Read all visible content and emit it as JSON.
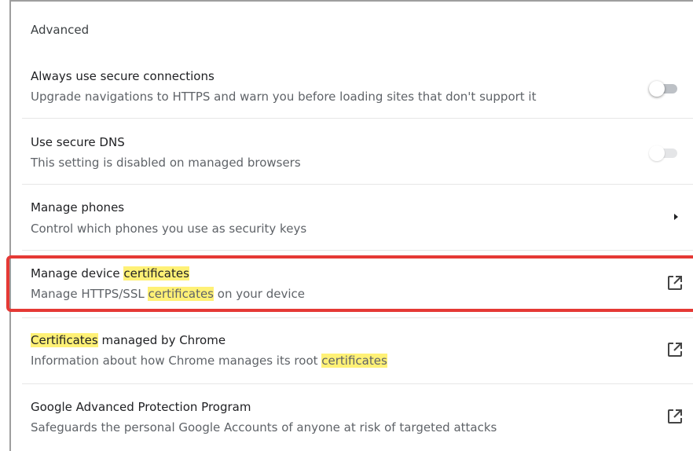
{
  "section_title": "Advanced",
  "highlight_term": "certificates",
  "colors": {
    "highlight": "#fff176",
    "focus_outline": "#e53935"
  },
  "rows": [
    {
      "title": "Always use secure connections",
      "subtitle": "Upgrade navigations to HTTPS and warn you before loading sites that don't support it",
      "control": "toggle",
      "toggle_state": "off"
    },
    {
      "title": "Use secure DNS",
      "subtitle": "This setting is disabled on managed browsers",
      "control": "toggle",
      "toggle_state": "off-disabled"
    },
    {
      "title": "Manage phones",
      "subtitle": "Control which phones you use as security keys",
      "control": "arrow-right-icon"
    },
    {
      "title_prefix": "Manage device ",
      "title_highlight": "certificates",
      "subtitle_prefix": "Manage HTTPS/SSL ",
      "subtitle_highlight": "certificates",
      "subtitle_suffix": " on your device",
      "control": "open-in-new-icon"
    },
    {
      "title_highlight": "Certificates",
      "title_suffix": " managed by Chrome",
      "subtitle_prefix": "Information about how Chrome manages its root ",
      "subtitle_highlight": "certificates",
      "control": "open-in-new-icon"
    },
    {
      "title": "Google Advanced Protection Program",
      "subtitle": "Safeguards the personal Google Accounts of anyone at risk of targeted attacks",
      "control": "open-in-new-icon"
    }
  ]
}
